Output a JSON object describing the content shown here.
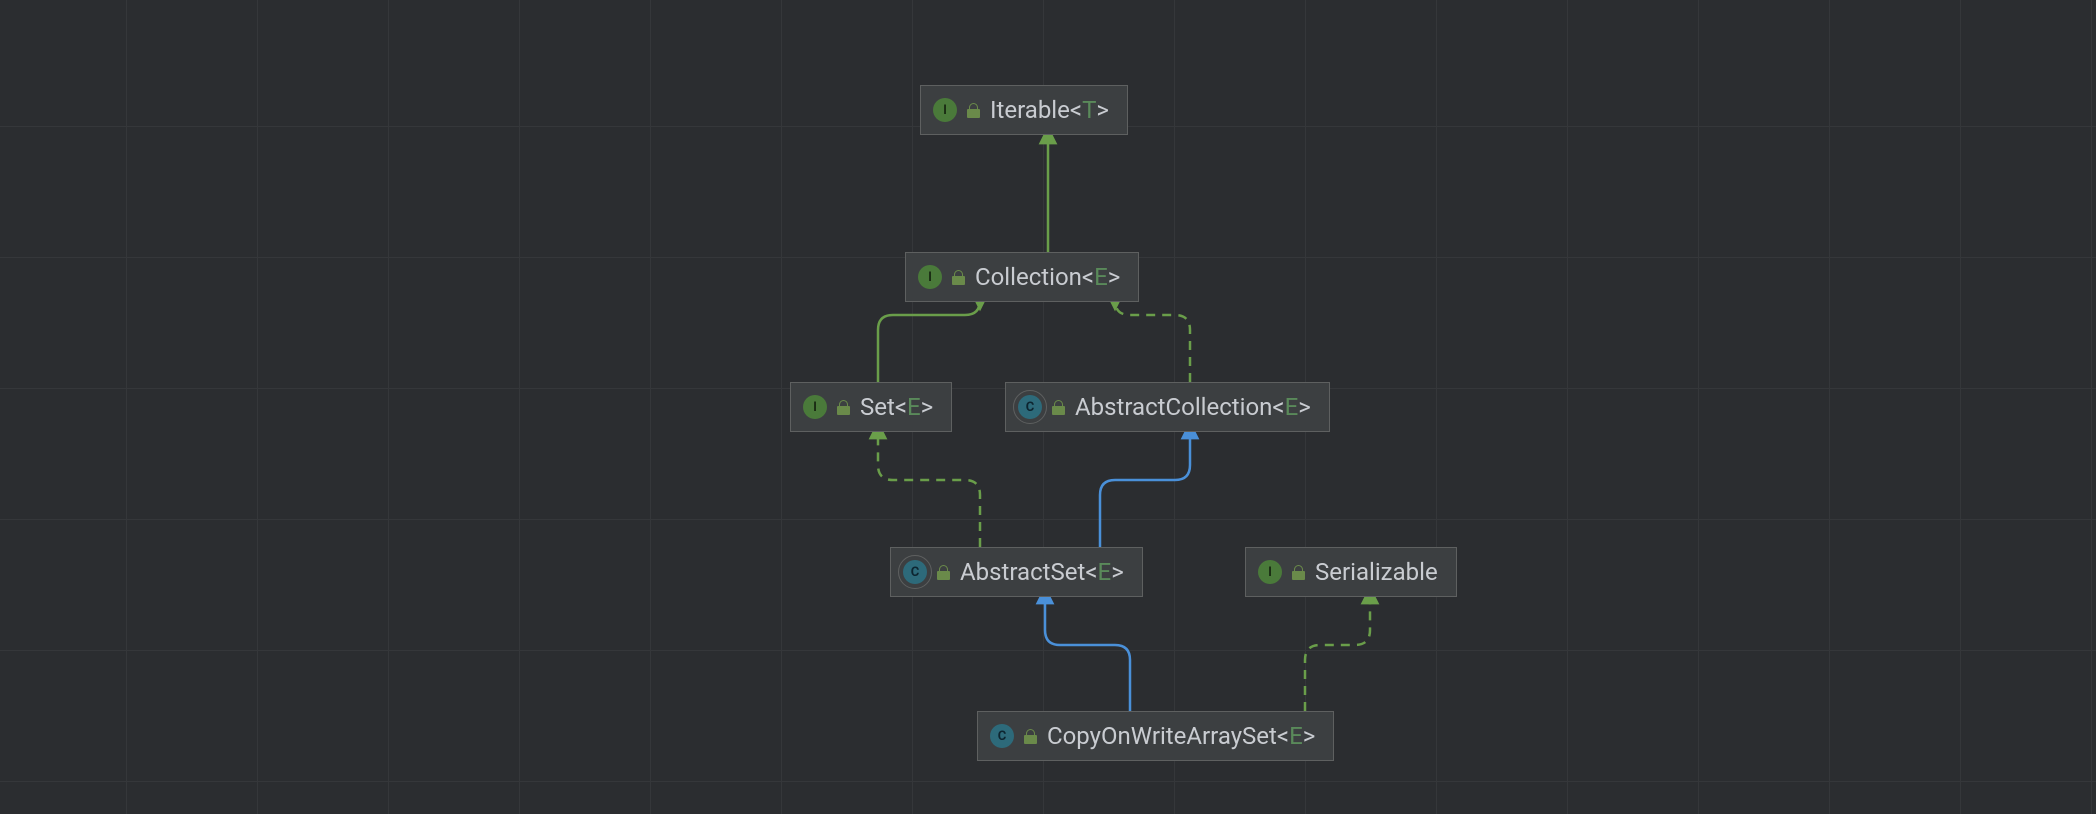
{
  "nodes": {
    "iterable": {
      "kind": "interface",
      "name": "Iterable",
      "type_param": "T"
    },
    "collection": {
      "kind": "interface",
      "name": "Collection",
      "type_param": "E"
    },
    "set": {
      "kind": "interface",
      "name": "Set",
      "type_param": "E"
    },
    "abstractcollection": {
      "kind": "abstract_class",
      "name": "AbstractCollection",
      "type_param": "E"
    },
    "abstractset": {
      "kind": "abstract_class",
      "name": "AbstractSet",
      "type_param": "E"
    },
    "serializable": {
      "kind": "interface",
      "name": "Serializable",
      "type_param": null
    },
    "copyonwritearrayset": {
      "kind": "class",
      "name": "CopyOnWriteArraySet",
      "type_param": "E"
    }
  },
  "edges": [
    {
      "from": "collection",
      "to": "iterable",
      "style": "extends_interface"
    },
    {
      "from": "set",
      "to": "collection",
      "style": "extends_interface"
    },
    {
      "from": "abstractcollection",
      "to": "collection",
      "style": "implements"
    },
    {
      "from": "abstractset",
      "to": "set",
      "style": "implements"
    },
    {
      "from": "abstractset",
      "to": "abstractcollection",
      "style": "extends_class"
    },
    {
      "from": "copyonwritearrayset",
      "to": "abstractset",
      "style": "extends_class"
    },
    {
      "from": "copyonwritearrayset",
      "to": "serializable",
      "style": "implements"
    }
  ],
  "colors": {
    "green": "#6a9e4a",
    "blue": "#4a90d9"
  },
  "badge_letters": {
    "interface": "I",
    "class": "C",
    "abstract_class": "C"
  }
}
